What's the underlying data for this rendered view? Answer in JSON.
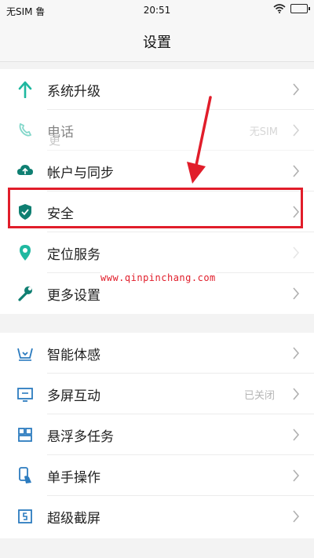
{
  "status_bar": {
    "carrier": "无SIM 鲁",
    "time": "20:51"
  },
  "header": {
    "title": "设置"
  },
  "section_1": {
    "items": [
      {
        "label": "系统升级",
        "icon": "arrow-up-icon",
        "value": ""
      },
      {
        "label": "电话",
        "icon": "phone-icon",
        "value": "无SIM"
      },
      {
        "label": "帐户与同步",
        "icon": "cloud-sync-icon",
        "value": ""
      },
      {
        "label": "安全",
        "icon": "shield-icon",
        "value": ""
      },
      {
        "label": "定位服务",
        "icon": "location-pin-icon",
        "value": ""
      },
      {
        "label": "更多设置",
        "icon": "wrench-icon",
        "value": ""
      }
    ]
  },
  "section_2": {
    "items": [
      {
        "label": "智能体感",
        "icon": "motion-sense-icon",
        "value": ""
      },
      {
        "label": "多屏互动",
        "icon": "multi-screen-icon",
        "value": "已关闭"
      },
      {
        "label": "悬浮多任务",
        "icon": "floating-multitask-icon",
        "value": ""
      },
      {
        "label": "单手操作",
        "icon": "one-hand-icon",
        "value": ""
      },
      {
        "label": "超级截屏",
        "icon": "screenshot-icon",
        "value": ""
      }
    ]
  },
  "overlays": {
    "watermark": "www.qinpinchang.com",
    "ghost_1": "更",
    "highlight_color": "#e11d2a"
  },
  "colors": {
    "icon_teal": "#1fb8a0",
    "icon_dark_teal": "#0f7f72",
    "accent_red": "#e11d2a"
  }
}
